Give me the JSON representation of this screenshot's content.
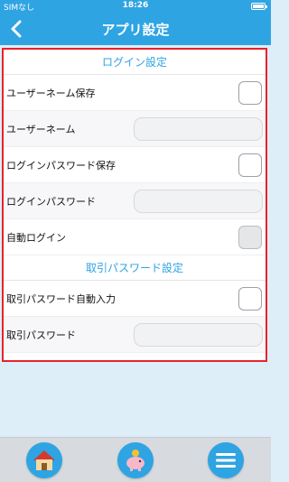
{
  "status": {
    "carrier": "SIMなし",
    "time": "18:26"
  },
  "nav": {
    "title": "アプリ設定"
  },
  "login_section": {
    "header": "ログイン設定",
    "save_username_label": "ユーザーネーム保存",
    "username_label": "ユーザーネーム",
    "save_password_label": "ログインパスワード保存",
    "password_label": "ログインパスワード",
    "auto_login_label": "自動ログイン"
  },
  "trade_section": {
    "header": "取引パスワード設定",
    "auto_fill_label": "取引パスワード自動入力",
    "trade_password_label": "取引パスワード"
  },
  "tabbar": {
    "items": [
      "home-icon",
      "piggy-bank-icon",
      "menu-icon"
    ]
  },
  "colors": {
    "accent": "#2fa4e3",
    "highlight_border": "#e8222a"
  }
}
